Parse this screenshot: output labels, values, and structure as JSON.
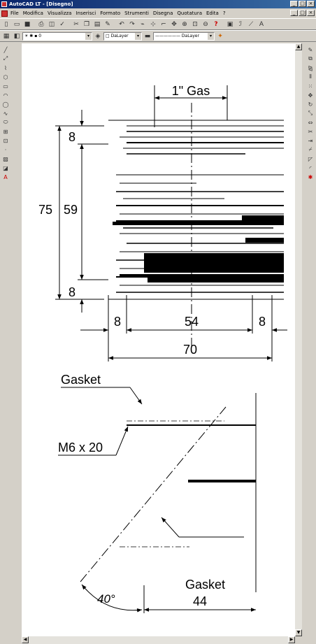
{
  "window": {
    "title": "AutoCAD LT - [Disegno]",
    "buttons": [
      "_",
      "□",
      "×"
    ]
  },
  "menu": {
    "items": [
      "File",
      "Modifica",
      "Visualizza",
      "Inserisci",
      "Formato",
      "Strumenti",
      "Disegna",
      "Quotatura",
      "Edita",
      "?"
    ],
    "doc_buttons": [
      "_",
      "□",
      "×"
    ]
  },
  "layer_bar": {
    "layer_value": "0",
    "color_value": "□ DaLayer",
    "linetype_value": "—————— DaLayer"
  },
  "drawing": {
    "top_view": {
      "gas_label": "1\" Gas",
      "dim_total_height": "75",
      "dim_inner_height": "59",
      "dim_top_margin": "8",
      "dim_bottom_margin": "8",
      "dim_left_width": "8",
      "dim_mid_width": "54",
      "dim_right_width": "8",
      "dim_total_width": "70"
    },
    "bottom_view": {
      "gasket_top": "Gasket",
      "bolt_label": "M6 x 20",
      "gasket_bottom": "Gasket",
      "angle_label": "40°",
      "dim_width": "44"
    }
  }
}
